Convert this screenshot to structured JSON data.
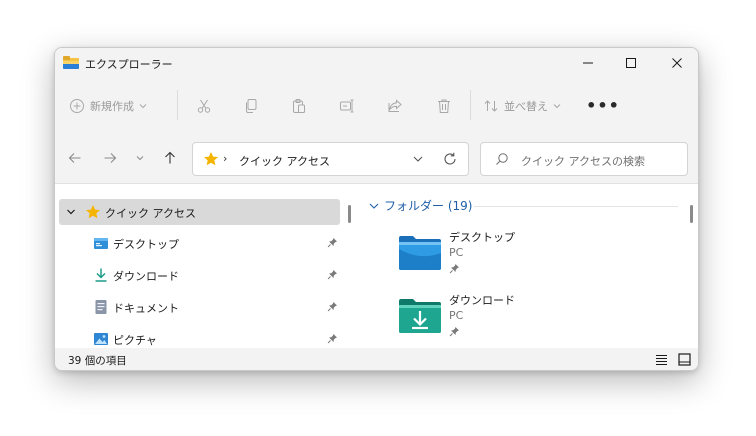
{
  "window": {
    "title": "エクスプローラー"
  },
  "commandbar": {
    "new_label": "新規作成",
    "sort_label": "並べ替え",
    "more_label": "•••"
  },
  "address": {
    "location": "クイック アクセス"
  },
  "search": {
    "placeholder": "クイック アクセスの検索"
  },
  "navpane": {
    "quick_access_label": "クイック アクセス",
    "items": [
      {
        "label": "デスクトップ",
        "icon": "desktop-folder-icon"
      },
      {
        "label": "ダウンロード",
        "icon": "download-icon"
      },
      {
        "label": "ドキュメント",
        "icon": "document-icon"
      },
      {
        "label": "ピクチャ",
        "icon": "picture-icon"
      }
    ]
  },
  "content": {
    "group_title": "フォルダー (19)",
    "folders": [
      {
        "name": "デスクトップ",
        "location": "PC",
        "icon": "desktop-folder-icon"
      },
      {
        "name": "ダウンロード",
        "location": "PC",
        "icon": "downloads-folder-icon"
      }
    ]
  },
  "status": {
    "item_count": "39 個の項目"
  },
  "colors": {
    "accent": "#1f5fa8",
    "star": "#f5b400",
    "selected_bg": "#d9d9d9",
    "chrome_bg": "#f3f3f3"
  }
}
